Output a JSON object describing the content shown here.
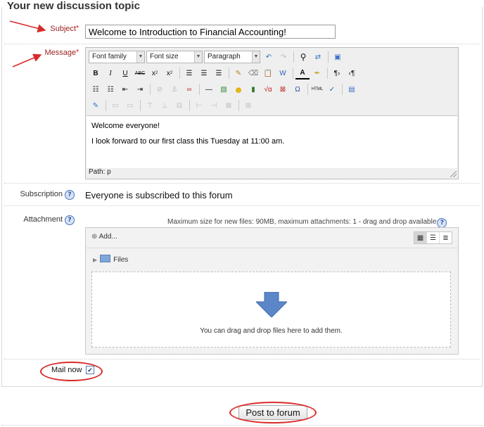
{
  "legend": "Your new discussion topic",
  "subject": {
    "label": "Subject",
    "required_mark": "*",
    "value": "Welcome to Introduction to Financial Accounting!"
  },
  "message": {
    "label": "Message",
    "required_mark": "*",
    "toolbar": {
      "font_family": "Font family",
      "font_size": "Font size",
      "format": "Paragraph"
    },
    "content": [
      "Welcome everyone!",
      "I look forward to our first class this Tuesday at 11:00 am."
    ],
    "path": "Path: p"
  },
  "subscription": {
    "label": "Subscription",
    "value": "Everyone is subscribed to this forum",
    "help": "?"
  },
  "attachment": {
    "label": "Attachment",
    "help": "?",
    "max_info": "Maximum size for new files: 90MB, maximum attachments: 1 - drag and drop available",
    "add_label": "Add...",
    "folder_label": "Files",
    "drop_text": "You can drag and drop files here to add them."
  },
  "mail_now": {
    "label": "Mail now",
    "checked": true
  },
  "post_button": "Post to forum",
  "colors": {
    "annotation": "#d92b2b",
    "required": "#9a1f1f",
    "drop_arrow": "#5b86c8"
  }
}
